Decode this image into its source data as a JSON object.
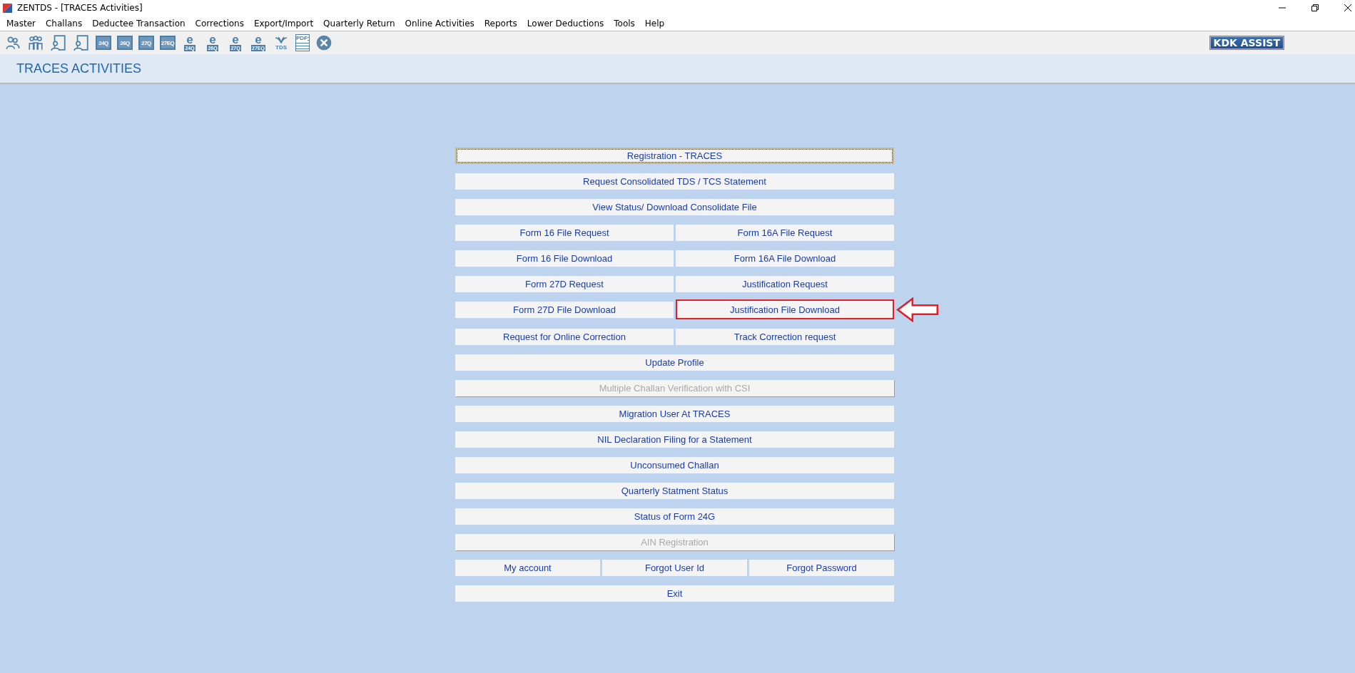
{
  "window": {
    "title": "ZENTDS - [TRACES Activities]"
  },
  "menu": [
    "Master",
    "Challans",
    "Deductee Transaction",
    "Corrections",
    "Export/Import",
    "Quarterly Return",
    "Online Activities",
    "Reports",
    "Lower Deductions",
    "Tools",
    "Help"
  ],
  "toolbar": [
    {
      "kind": "user"
    },
    {
      "kind": "users"
    },
    {
      "kind": "doc-user"
    },
    {
      "kind": "doc-user"
    },
    {
      "kind": "form",
      "label": "24Q"
    },
    {
      "kind": "form",
      "label": "26Q"
    },
    {
      "kind": "form",
      "label": "27Q"
    },
    {
      "kind": "form",
      "label": "27EQ"
    },
    {
      "kind": "eform",
      "mark": "e",
      "label": "24Q"
    },
    {
      "kind": "eform",
      "mark": "e",
      "label": "26Q"
    },
    {
      "kind": "eform",
      "mark": "e",
      "label": "27Q"
    },
    {
      "kind": "eform",
      "mark": "e",
      "label": "27EQ"
    },
    {
      "kind": "tds",
      "label": "TDS"
    },
    {
      "kind": "pdf",
      "label": "PDF"
    },
    {
      "kind": "close"
    }
  ],
  "assist_button": "KDK ASSIST",
  "page_title": "TRACES ACTIVITIES",
  "rows": [
    {
      "buttons": [
        {
          "label": "Registration - TRACES",
          "disabled": false,
          "focused": true,
          "highlighted": false
        }
      ]
    },
    {
      "buttons": [
        {
          "label": "Request Consolidated TDS / TCS Statement",
          "disabled": false,
          "focused": false,
          "highlighted": false
        }
      ]
    },
    {
      "buttons": [
        {
          "label": "View Status/ Download Consolidate File",
          "disabled": false,
          "focused": false,
          "highlighted": false
        }
      ]
    },
    {
      "buttons": [
        {
          "label": "Form 16 File Request",
          "disabled": false,
          "focused": false,
          "highlighted": false
        },
        {
          "label": "Form 16A File Request",
          "disabled": false,
          "focused": false,
          "highlighted": false
        }
      ]
    },
    {
      "buttons": [
        {
          "label": "Form 16 File Download",
          "disabled": false,
          "focused": false,
          "highlighted": false
        },
        {
          "label": "Form 16A File Download",
          "disabled": false,
          "focused": false,
          "highlighted": false
        }
      ]
    },
    {
      "buttons": [
        {
          "label": "Form 27D Request",
          "disabled": false,
          "focused": false,
          "highlighted": false
        },
        {
          "label": "Justification Request",
          "disabled": false,
          "focused": false,
          "highlighted": false
        }
      ]
    },
    {
      "buttons": [
        {
          "label": "Form 27D File Download",
          "disabled": false,
          "focused": false,
          "highlighted": false
        },
        {
          "label": "Justification File Download",
          "disabled": false,
          "focused": false,
          "highlighted": true
        }
      ]
    },
    {
      "buttons": [
        {
          "label": "Request for Online Correction",
          "disabled": false,
          "focused": false,
          "highlighted": false
        },
        {
          "label": "Track Correction request",
          "disabled": false,
          "focused": false,
          "highlighted": false
        }
      ]
    },
    {
      "buttons": [
        {
          "label": "Update Profile",
          "disabled": false,
          "focused": false,
          "highlighted": false
        }
      ]
    },
    {
      "buttons": [
        {
          "label": "Multiple Challan Verification with CSI",
          "disabled": true,
          "focused": false,
          "highlighted": false
        }
      ]
    },
    {
      "buttons": [
        {
          "label": "Migration User At TRACES",
          "disabled": false,
          "focused": false,
          "highlighted": false
        }
      ]
    },
    {
      "buttons": [
        {
          "label": "NIL Declaration Filing for a Statement",
          "disabled": false,
          "focused": false,
          "highlighted": false
        }
      ]
    },
    {
      "buttons": [
        {
          "label": "Unconsumed Challan",
          "disabled": false,
          "focused": false,
          "highlighted": false
        }
      ]
    },
    {
      "buttons": [
        {
          "label": "Quarterly Statment Status",
          "disabled": false,
          "focused": false,
          "highlighted": false
        }
      ]
    },
    {
      "buttons": [
        {
          "label": "Status of Form 24G",
          "disabled": false,
          "focused": false,
          "highlighted": false
        }
      ]
    },
    {
      "buttons": [
        {
          "label": "AIN Registration",
          "disabled": true,
          "focused": false,
          "highlighted": false
        }
      ]
    },
    {
      "buttons": [
        {
          "label": "My account",
          "disabled": false,
          "focused": false,
          "highlighted": false
        },
        {
          "label": "Forgot User Id",
          "disabled": false,
          "focused": false,
          "highlighted": false
        },
        {
          "label": "Forgot Password",
          "disabled": false,
          "focused": false,
          "highlighted": false
        }
      ]
    },
    {
      "buttons": [
        {
          "label": "Exit",
          "disabled": false,
          "focused": false,
          "highlighted": false
        }
      ]
    }
  ]
}
